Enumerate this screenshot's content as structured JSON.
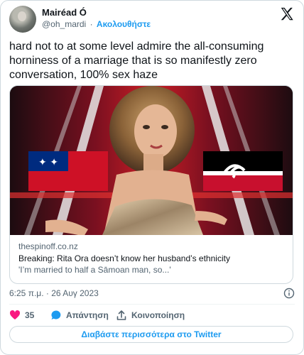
{
  "author": {
    "display_name": "Mairéad Ó",
    "handle": "@oh_mardi",
    "separator": "·",
    "follow_label": "Ακολουθήστε"
  },
  "tweet": {
    "text": "hard not to at some level admire the all-consuming horniness of a marriage that is so manifestly zero conversation, 100% sex haze",
    "timestamp": "6:25 π.μ. · 26 Αυγ 2023"
  },
  "card": {
    "domain": "thespinoff.co.nz",
    "title": "Breaking: Rita Ora doesn’t know her husband’s ethnicity",
    "description": "'I’m married to half a Sāmoan man, so...'"
  },
  "actions": {
    "like_count": "35",
    "reply_label": "Απάντηση",
    "share_label": "Κοινοποίηση",
    "read_more_label": "Διαβάστε περισσότερα στο Twitter"
  },
  "colors": {
    "accent": "#1d9bf0",
    "like": "#f91880",
    "secondary_text": "#536471",
    "border": "#cfd9de"
  },
  "icons": [
    "x-logo-icon",
    "info-icon",
    "heart-icon",
    "reply-bubble-icon",
    "share-icon"
  ]
}
